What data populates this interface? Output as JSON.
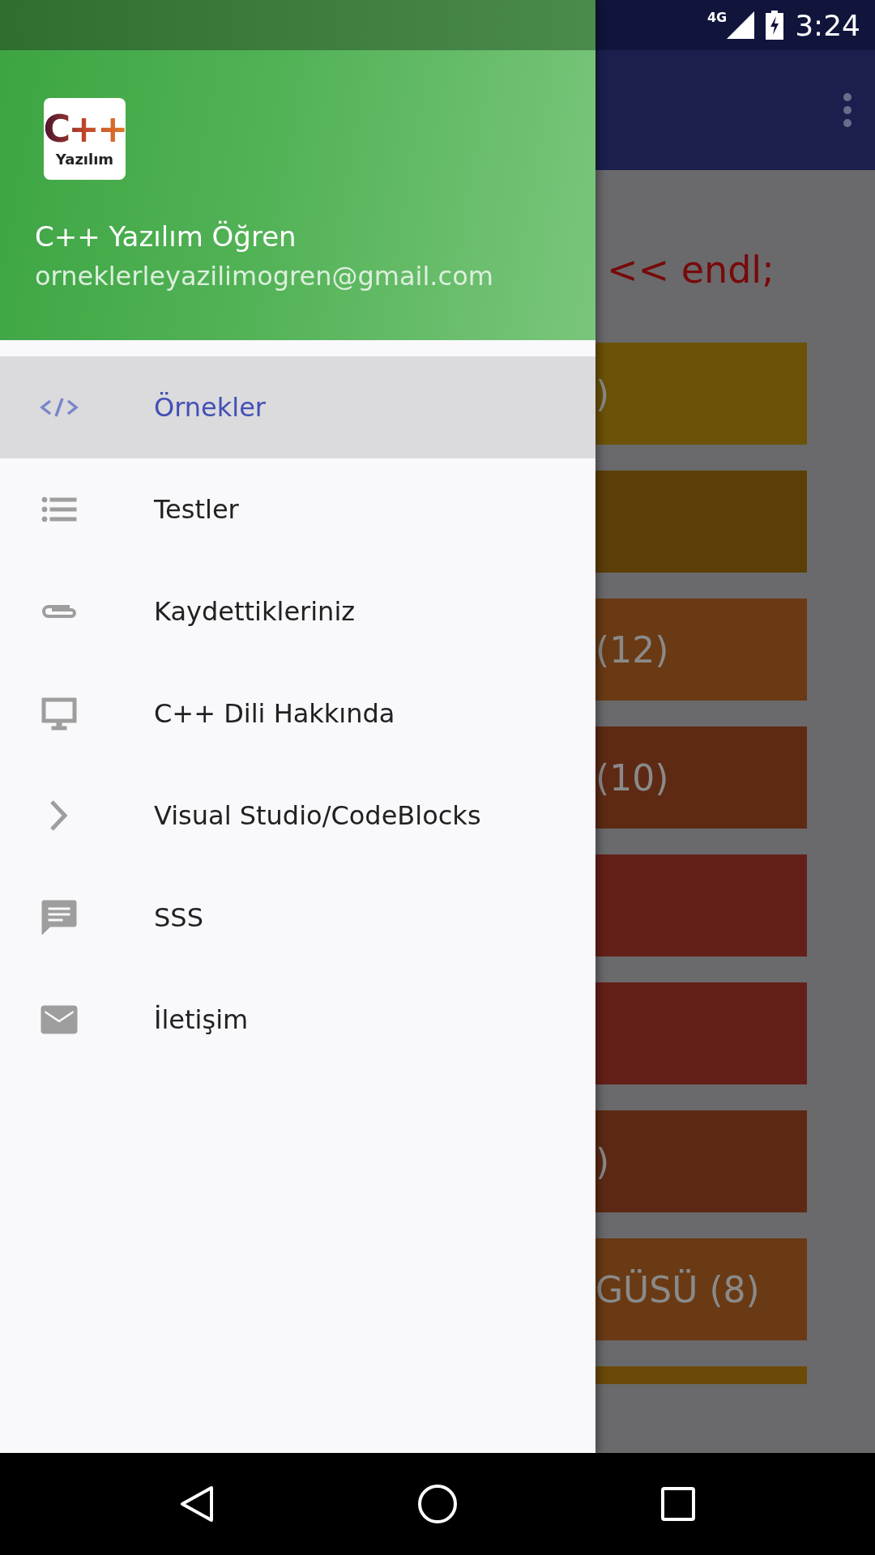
{
  "status_bar": {
    "network": "4G",
    "time": "3:24"
  },
  "drawer": {
    "logo": {
      "line_1": "C++",
      "line_2": "Yazılım"
    },
    "title": "C++ Yazılım Öğren",
    "email": "orneklerleyazilimogren@gmail.com",
    "items": [
      {
        "label": "Örnekler",
        "selected": true
      },
      {
        "label": "Testler",
        "selected": false
      },
      {
        "label": "Kaydettikleriniz",
        "selected": false
      },
      {
        "label": "C++ Dili Hakkında",
        "selected": false
      },
      {
        "label": "Visual Studio/CodeBlocks",
        "selected": false
      },
      {
        "label": "SSS",
        "selected": false
      },
      {
        "label": "İletişim",
        "selected": false
      }
    ]
  },
  "background": {
    "code_line": "<< endl;",
    "cards": [
      {
        "label": ")",
        "color": "#6b5208"
      },
      {
        "color": "#5c3f08"
      },
      {
        "label": "(12)",
        "color": "#6a3a14"
      },
      {
        "label": "(10)",
        "color": "#5e2a14"
      },
      {
        "color": "#632019"
      },
      {
        "color": "#632019"
      },
      {
        "label": ")",
        "color": "#5c2a14"
      },
      {
        "label": "GÜSÜ (8)",
        "color": "#6a3a14"
      },
      {
        "color": "#6b4a08"
      }
    ]
  }
}
